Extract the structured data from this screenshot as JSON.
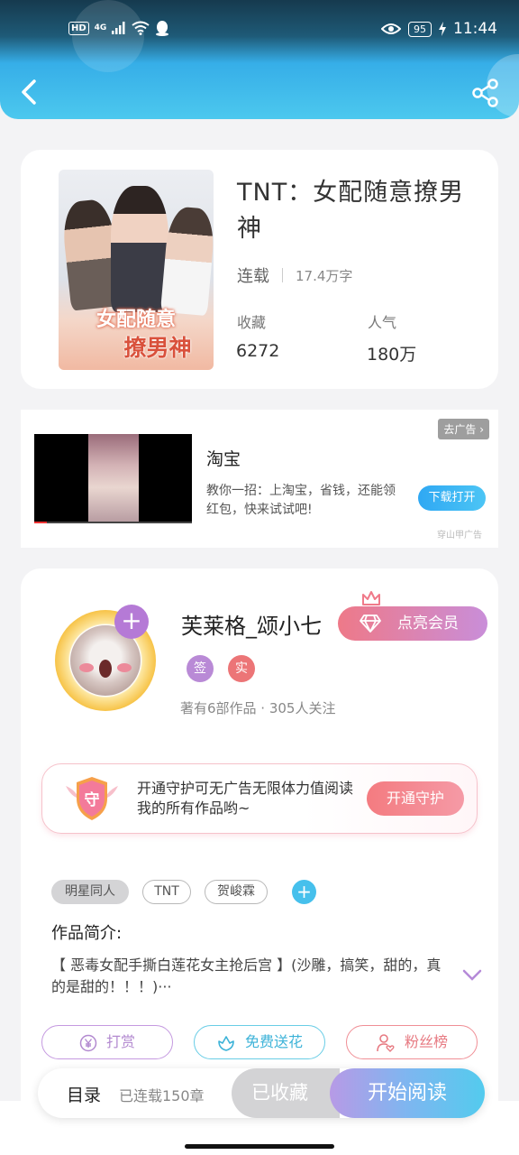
{
  "status_bar": {
    "hd": "HD",
    "network": "4G",
    "battery": "95",
    "time": "11:44"
  },
  "header": {
    "back_icon": "chevron-left-icon",
    "share_icon": "share-icon",
    "accent": "#36aee8"
  },
  "book": {
    "title": "TNT：女配随意撩男神",
    "cover_title_top": "女配随意",
    "cover_title_bottom": "撩男神",
    "status": "连载",
    "word_count": "17.4万字",
    "favorites_label": "收藏",
    "favorites_value": "6272",
    "popularity_label": "人气",
    "popularity_value": "180万"
  },
  "ad": {
    "remove_label": "去广告 ›",
    "app_name": "淘宝",
    "description": "教你一招：上淘宝，省钱，还能领红包，快来试试吧!",
    "download_label": "下载打开",
    "source": "穿山甲广告"
  },
  "author": {
    "name": "芙莱格_颂小七",
    "vip_label": "点亮会员",
    "badge_sign": "签",
    "badge_real": "实",
    "stats": "著有6部作品 · 305人关注",
    "plus": "+"
  },
  "guard": {
    "icon_char": "守",
    "text": "开通守护可无广告无限体力值阅读我的所有作品哟~",
    "button_label": "开通守护"
  },
  "tags": {
    "items": [
      "明星同人",
      "TNT",
      "贺峻霖"
    ],
    "add": "+"
  },
  "intro": {
    "label": "作品简介:",
    "text": "【 恶毒女配手撕白莲花女主抢后宫 】(沙雕，搞笑，甜的，真的是甜的！！！)···"
  },
  "actions": {
    "reward": "打赏",
    "flower": "免费送花",
    "fans": "粉丝榜"
  },
  "bottom": {
    "toc_label": "目录",
    "toc_count": "已连载150章",
    "collected_label": "已收藏",
    "read_label": "开始阅读"
  }
}
